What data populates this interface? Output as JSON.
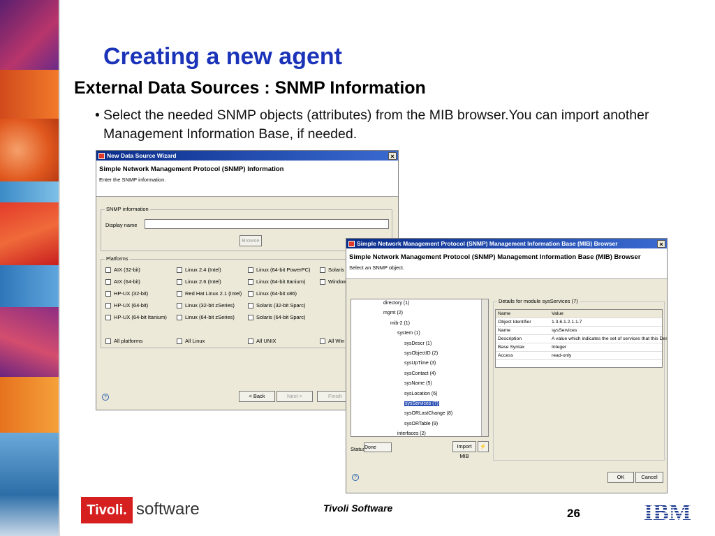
{
  "slide": {
    "title": "Creating a new agent",
    "subtitle": "External Data Sources : SNMP Information",
    "bullet_marker": "•",
    "bullet": "Select the needed SNMP objects (attributes) from the MIB browser.You can import another Management Information Base, if needed."
  },
  "wizard": {
    "title": "New Data Source Wizard",
    "close": "×",
    "header_title": "Simple Network Management Protocol (SNMP) Information",
    "header_desc": "Enter the SNMP information.",
    "snmp_group_label": "SNMP information",
    "display_name_label": "Display name",
    "display_name_value": "",
    "browse_label": "Browse",
    "platforms_label": "Platforms",
    "platforms": [
      [
        "AIX (32-bit)",
        "Linux 2.4 (Intel)",
        "Linux (64-bit PowerPC)",
        "Solaris"
      ],
      [
        "AIX (64-bit)",
        "Linux 2.6 (Intel)",
        "Linux (64-bit Itanium)",
        "Window"
      ],
      [
        "HP-UX (32-bit)",
        "Red Hat Linux 2.1 (Intel)",
        "Linux (64-bit x86)",
        ""
      ],
      [
        "HP-UX (64-bit)",
        "Linux (32-bit zSeries)",
        "Solaris (32-bit Sparc)",
        ""
      ],
      [
        "HP-UX (64-bit Itanium)",
        "Linux (64-bit zSeries)",
        "Solaris (64-bit Sparc)",
        ""
      ]
    ],
    "all_options": [
      "All platforms",
      "All Linux",
      "All UNIX",
      "All Win"
    ],
    "help": "?",
    "back_label": "< Back",
    "next_label": "Next >",
    "finish_label": "Finish"
  },
  "mib": {
    "title": "Simple Network Management Protocol (SNMP) Management Information Base (MIB) Browser",
    "close": "×",
    "header_title": "Simple Network Management Protocol (SNMP) Management Information Base (MIB) Browser",
    "header_desc": "Select an SNMP object.",
    "tree": [
      {
        "label": "directory (1)",
        "level": 0
      },
      {
        "label": "mgmt (2)",
        "level": 0
      },
      {
        "label": "mib-2 (1)",
        "level": 1
      },
      {
        "label": "system (1)",
        "level": 2
      },
      {
        "label": "sysDescr (1)",
        "level": 3
      },
      {
        "label": "sysObjectID (2)",
        "level": 3
      },
      {
        "label": "sysUpTime (3)",
        "level": 3
      },
      {
        "label": "sysContact (4)",
        "level": 3
      },
      {
        "label": "sysName (5)",
        "level": 3
      },
      {
        "label": "sysLocation (6)",
        "level": 3
      },
      {
        "label": "sysServices (7)",
        "level": 3,
        "selected": true
      },
      {
        "label": "sysORLastChange (8)",
        "level": 3
      },
      {
        "label": "sysORTable (9)",
        "level": 3
      },
      {
        "label": "interfaces (2)",
        "level": 2
      }
    ],
    "details_label": "Details for module sysServices (7)",
    "details_headers": [
      "Name",
      "Value"
    ],
    "details": [
      [
        "Object Identifier",
        "1.3.6.1.2.1.1.7"
      ],
      [
        "Name",
        "sysServices"
      ],
      [
        "Description",
        "A value which indicates the set of services that this Dent..."
      ],
      [
        "Base Syntax",
        "Integer"
      ],
      [
        "Access",
        "read-only"
      ]
    ],
    "status_label": "Status",
    "status_value": "Done",
    "import_label": "Import MIB",
    "help": "?",
    "ok_label": "OK",
    "cancel_label": "Cancel"
  },
  "footer": {
    "brand_red": "Tivoli.",
    "brand_text": "software",
    "center": "Tivoli Software",
    "page": "26",
    "ibm": "IBM"
  },
  "colors": {
    "title": "#1a33b8",
    "titlebar": "#0a2d8a",
    "brand_red": "#d62020",
    "selection": "#2a4fb4"
  }
}
